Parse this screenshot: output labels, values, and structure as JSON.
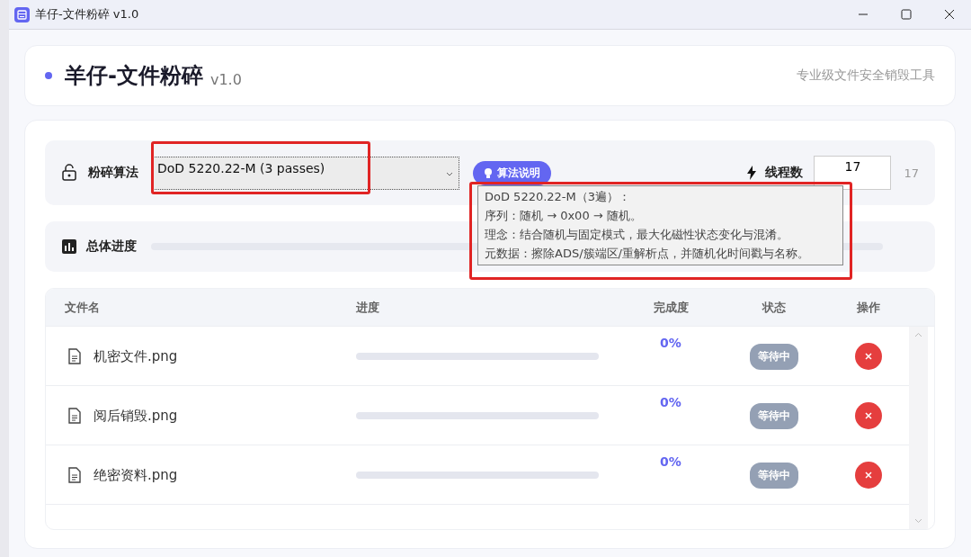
{
  "window": {
    "title": "羊仔-文件粉碎 v1.0"
  },
  "header": {
    "title": "羊仔-文件粉碎",
    "version": "v1.0",
    "subtitle": "专业级文件安全销毁工具"
  },
  "settings": {
    "algorithm_label": "粉碎算法",
    "algorithm": "DoD 5220.22-M (3 passes)",
    "info_button": "算法说明",
    "threads_label": "线程数",
    "threads": "17",
    "threads_readout": "17"
  },
  "tooltip": {
    "lines": [
      "DoD 5220.22-M（3遍）：",
      "序列：随机 → 0x00 → 随机。",
      "理念：结合随机与固定模式，最大化磁性状态变化与混淆。",
      "元数据：擦除ADS/簇端区/重解析点，并随机化时间戳与名称。"
    ]
  },
  "overall": {
    "label": "总体进度",
    "level": 0
  },
  "table": {
    "columns": [
      "文件名",
      "进度",
      "完成度",
      "状态",
      "操作"
    ],
    "rows": [
      {
        "name": "机密文件.png",
        "level": 0,
        "percent": "0%",
        "status": "等待中"
      },
      {
        "name": "阅后销毁.png",
        "level": 0,
        "percent": "0%",
        "status": "等待中"
      },
      {
        "name": "绝密资料.png",
        "level": 0,
        "percent": "0%",
        "status": "等待中"
      }
    ]
  },
  "annotations": [
    {
      "kind": "highlight"
    },
    {
      "kind": "highlight"
    }
  ]
}
